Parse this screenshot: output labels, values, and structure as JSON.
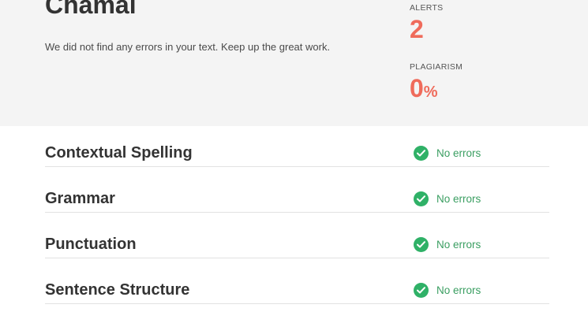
{
  "summary": {
    "title": "Chamal",
    "message": "We did not find any errors in your text. Keep up the great work.",
    "alerts": {
      "label": "ALERTS",
      "value": "2"
    },
    "plagiarism": {
      "label": "PLAGIARISM",
      "value": "0",
      "unit": "%"
    }
  },
  "checks": [
    {
      "name": "Contextual Spelling",
      "status": "No errors"
    },
    {
      "name": "Grammar",
      "status": "No errors"
    },
    {
      "name": "Punctuation",
      "status": "No errors"
    },
    {
      "name": "Sentence Structure",
      "status": "No errors"
    }
  ],
  "icons": {
    "status": "check-circle-icon"
  },
  "colors": {
    "accent_red": "#ef6b5b",
    "success_green": "#2fb167",
    "success_text": "#3a9e61"
  }
}
